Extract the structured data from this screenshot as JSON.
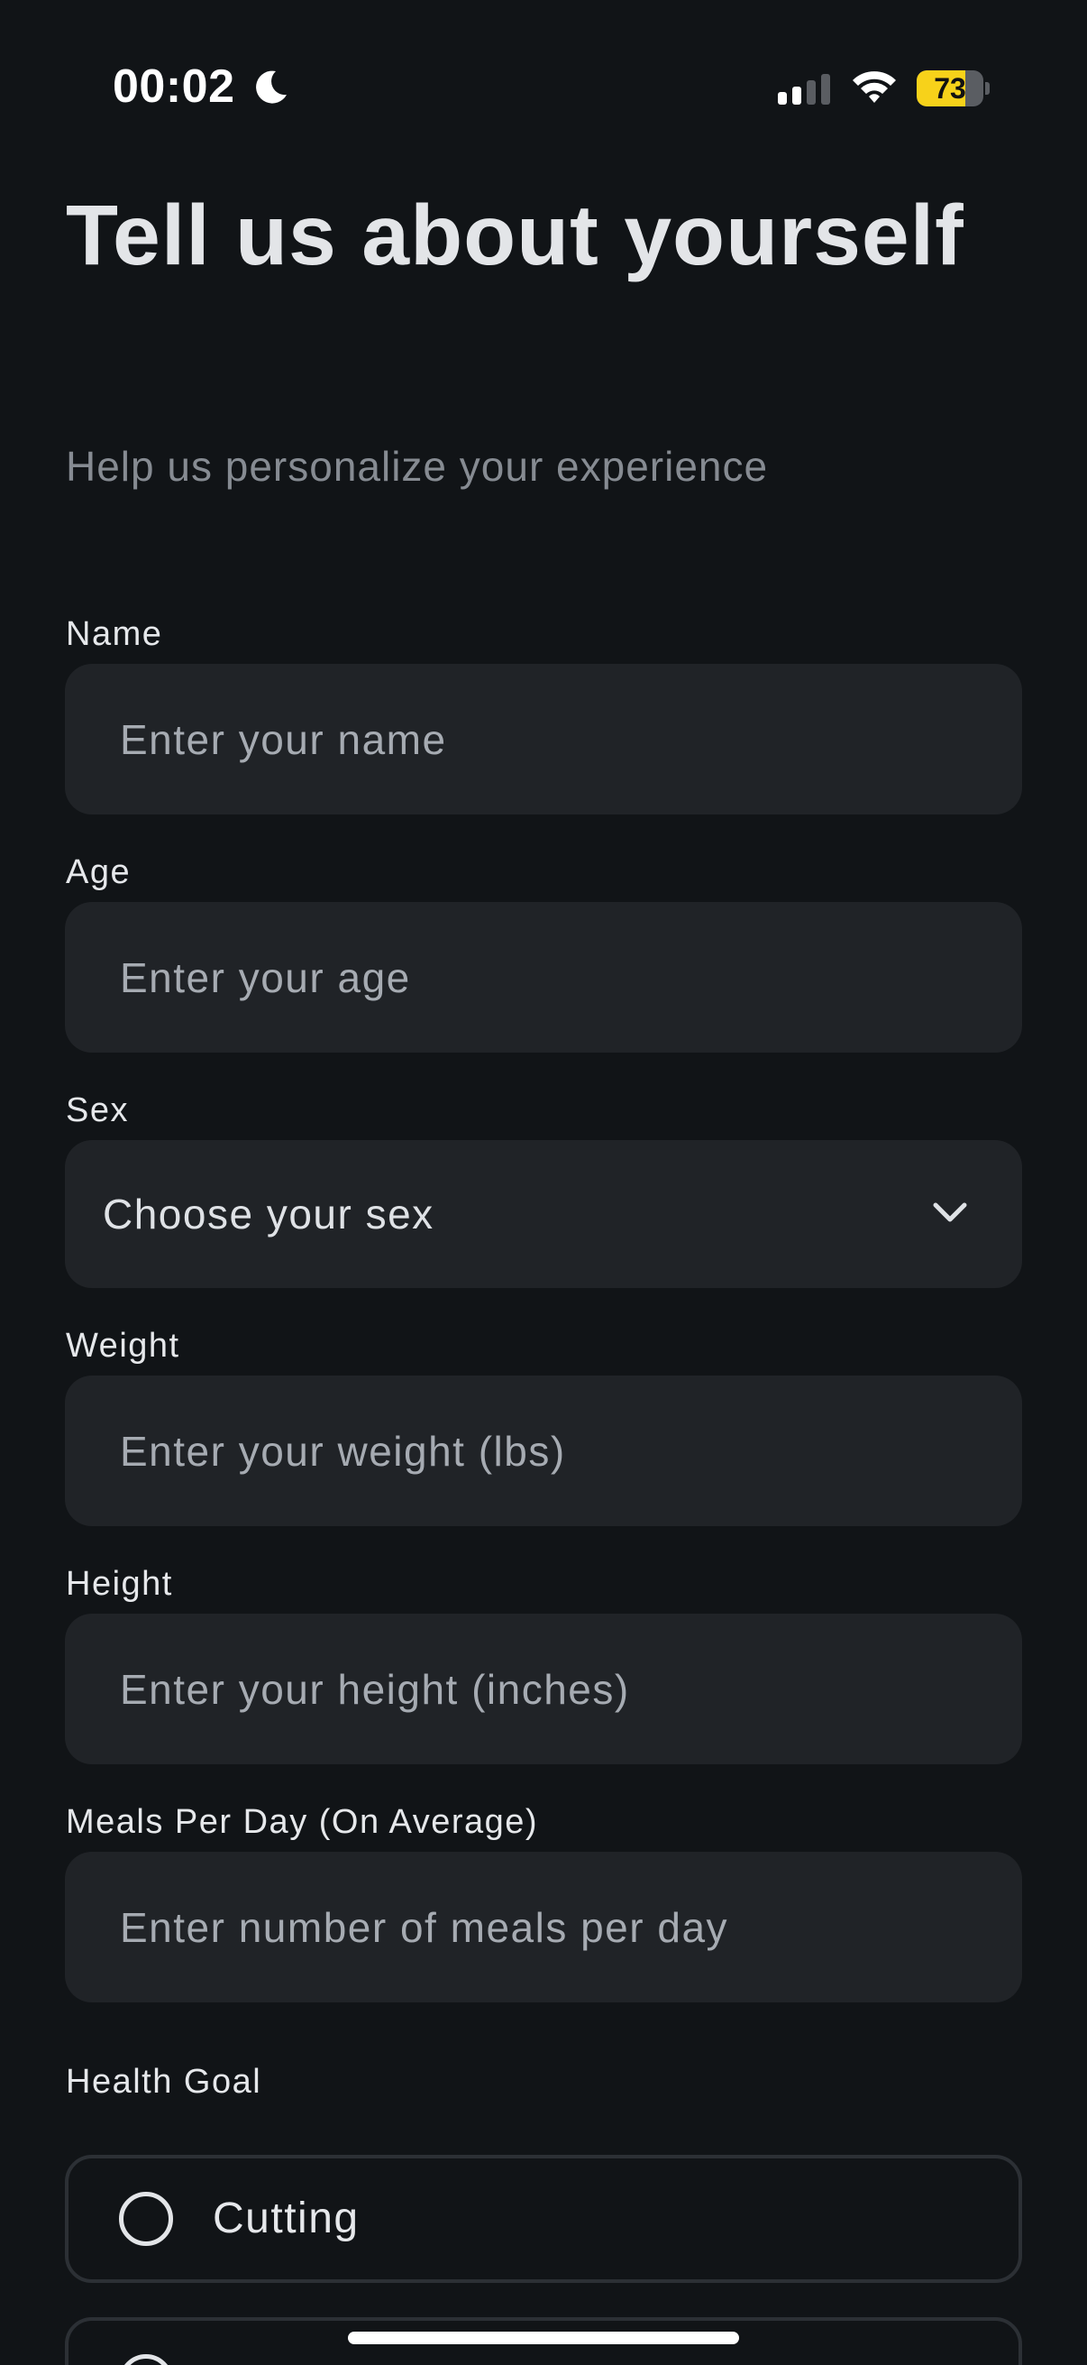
{
  "status_bar": {
    "time": "00:02",
    "battery_level": "73",
    "battery_fraction": 0.73,
    "icons": [
      "moon-icon",
      "signal-icon",
      "wifi-icon",
      "battery-icon"
    ]
  },
  "header": {
    "title": "Tell us about yourself",
    "subtitle": "Help us personalize your experience"
  },
  "form": {
    "name": {
      "label": "Name",
      "placeholder": "Enter your name",
      "value": ""
    },
    "age": {
      "label": "Age",
      "placeholder": "Enter your age",
      "value": ""
    },
    "sex": {
      "label": "Sex",
      "selected": "Choose your sex"
    },
    "weight": {
      "label": "Weight",
      "placeholder": "Enter your weight (lbs)",
      "value": ""
    },
    "height": {
      "label": "Height",
      "placeholder": "Enter your height (inches)",
      "value": ""
    },
    "meals": {
      "label": "Meals Per Day (On Average)",
      "placeholder": "Enter number of meals per day",
      "value": ""
    },
    "health_goal": {
      "label": "Health Goal",
      "options": [
        {
          "label": "Cutting",
          "selected": false
        },
        {
          "label": "",
          "selected": false
        }
      ]
    }
  },
  "colors": {
    "background": "#111417",
    "field_background": "#202327",
    "battery_accent": "#f7d21a",
    "placeholder": "#a6abb2",
    "subtitle": "#868b92"
  }
}
